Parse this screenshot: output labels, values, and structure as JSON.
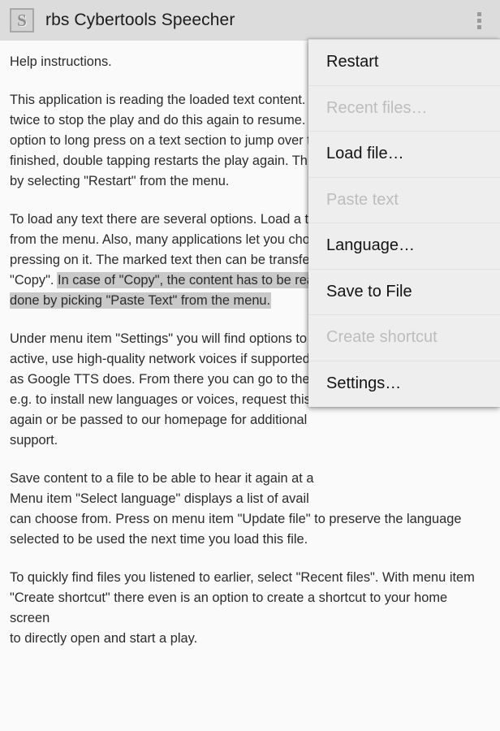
{
  "titlebar": {
    "app_icon_letter": "S",
    "title": "rbs Cybertools Speecher",
    "overflow_icon": "overflow-menu-vertical-dots-icon"
  },
  "content": {
    "paragraphs": [
      {
        "id": "heading",
        "text": "Help instructions."
      },
      {
        "id": "p1",
        "text": "This application is reading the loaded text content. \ntwice to stop the play and do this again to resume. \noption to long press on a text section to jump over t\nfinished, double tapping restarts the play again. Th\nby selecting \"Restart\" from the menu."
      },
      {
        "id": "p2",
        "before": "To load any text there are several options. Load a te\nfrom the menu. Also, many applications let you cho\npressing on it. The marked text then can be transfe\n\"Copy\". ",
        "highlight": "In case of \"Copy\", the content has to be rea\ndone by picking \"Paste Text\" from the menu."
      },
      {
        "id": "p3",
        "text": "Under menu item \"Settings\" you will find options to \nactive, use high-quality network voices if supported\nas Google TTS does. From there you can go to the T\ne.g. to install new languages or voices, request this\nagain or be passed to our homepage for additional \nsupport."
      },
      {
        "id": "p4",
        "text": "Save content to a file to be able to hear it again at a\nMenu item \"Select language\" displays a list of avail\ncan choose from. Press on menu item \"Update file\" to preserve the language\nselected to be used the next time you load this file."
      },
      {
        "id": "p5",
        "text": "To quickly find files you listened to earlier, select \"Recent files\". With menu item\n\"Create shortcut\" there even is an option to create a shortcut to your home screen\nto directly open and start a play."
      }
    ]
  },
  "overflow_menu": {
    "items": [
      {
        "label": "Restart",
        "enabled": true
      },
      {
        "label": "Recent files…",
        "enabled": false
      },
      {
        "label": "Load file…",
        "enabled": true
      },
      {
        "label": "Paste text",
        "enabled": false
      },
      {
        "label": "Language…",
        "enabled": true
      },
      {
        "label": "Save to File",
        "enabled": true
      },
      {
        "label": "Create shortcut",
        "enabled": false
      },
      {
        "label": "Settings…",
        "enabled": true
      }
    ]
  },
  "colors": {
    "titlebar_bg": "#dcdcdc",
    "page_bg": "#fafafa",
    "menu_bg": "#eeeeee",
    "text": "#2b2b2b",
    "disabled_text": "#bdbdbd",
    "selection_highlight": "#c9c9c9"
  }
}
